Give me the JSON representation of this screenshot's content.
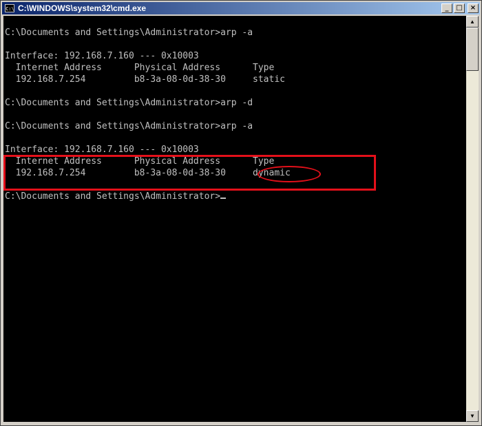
{
  "window": {
    "title": "C:\\WINDOWS\\system32\\cmd.exe",
    "icon_label": "C:\\",
    "buttons": {
      "minimize": "_",
      "maximize": "□",
      "close": "×"
    }
  },
  "console": {
    "lines": [
      "",
      "C:\\Documents and Settings\\Administrator>arp -a",
      "",
      "Interface: 192.168.7.160 --- 0x10003",
      "  Internet Address      Physical Address      Type",
      "  192.168.7.254         b8-3a-08-0d-38-30     static",
      "",
      "C:\\Documents and Settings\\Administrator>arp -d",
      "",
      "C:\\Documents and Settings\\Administrator>arp -a",
      "",
      "Interface: 192.168.7.160 --- 0x10003",
      "  Internet Address      Physical Address      Type",
      "  192.168.7.254         b8-3a-08-0d-38-30     dynamic",
      "",
      "C:\\Documents and Settings\\Administrator>"
    ]
  },
  "annotation_color": "#e4101a",
  "scrollbar": {
    "up_arrow": "▲",
    "down_arrow": "▼",
    "position": 0
  }
}
